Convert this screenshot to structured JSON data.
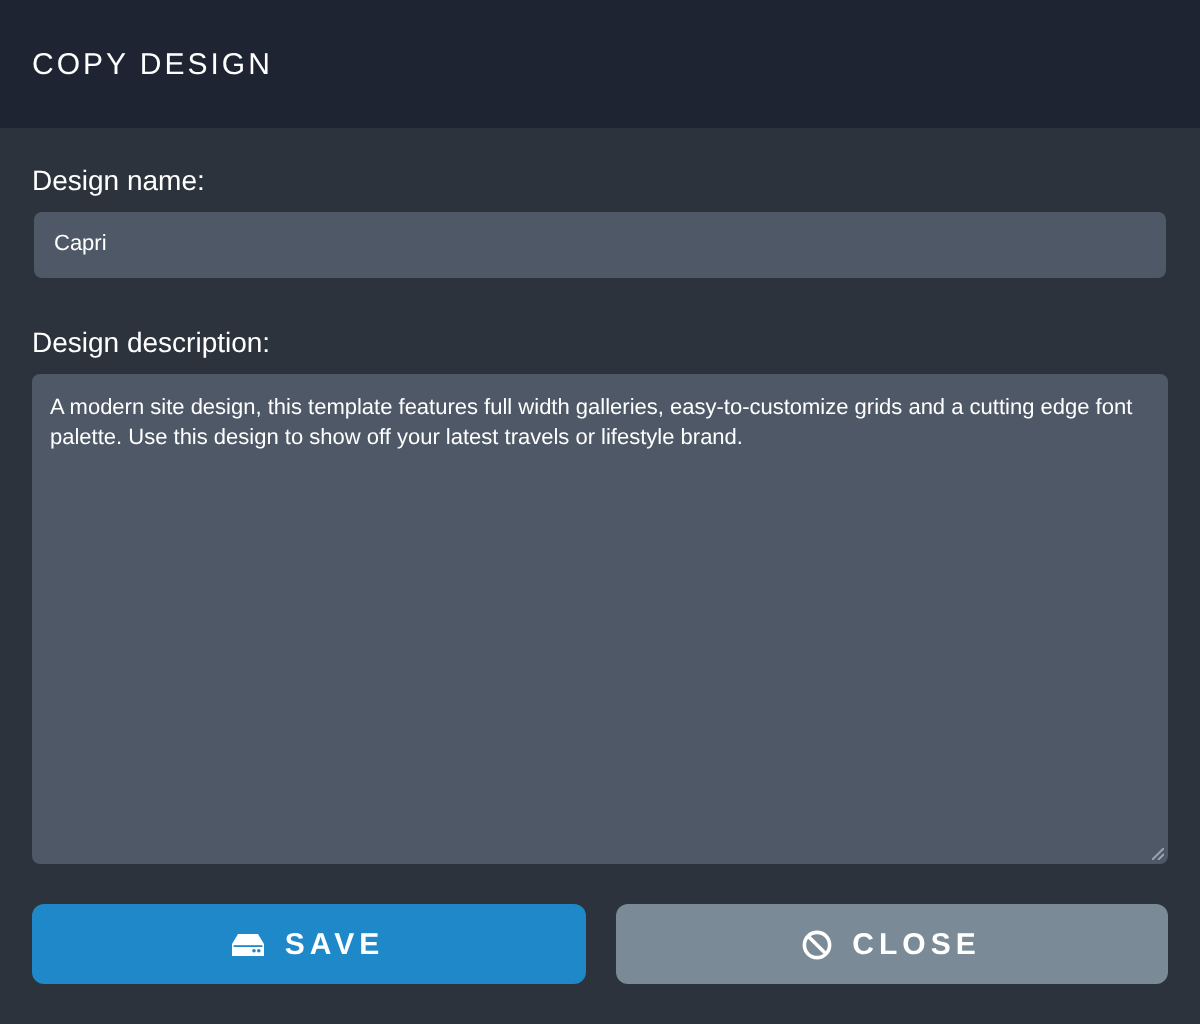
{
  "dialog": {
    "title": "COPY DESIGN"
  },
  "fields": [
    {
      "kind": "input",
      "label": "Design name:",
      "value": "Capri"
    },
    {
      "kind": "textarea",
      "label": "Design description:",
      "value": "A modern site design, this template features full width galleries, easy-to-customize grids and a cutting edge font palette. Use this design to show off your latest travels or lifestyle brand."
    }
  ],
  "buttons": [
    {
      "kind": "save",
      "label": "SAVE"
    },
    {
      "kind": "close",
      "label": "CLOSE"
    }
  ]
}
